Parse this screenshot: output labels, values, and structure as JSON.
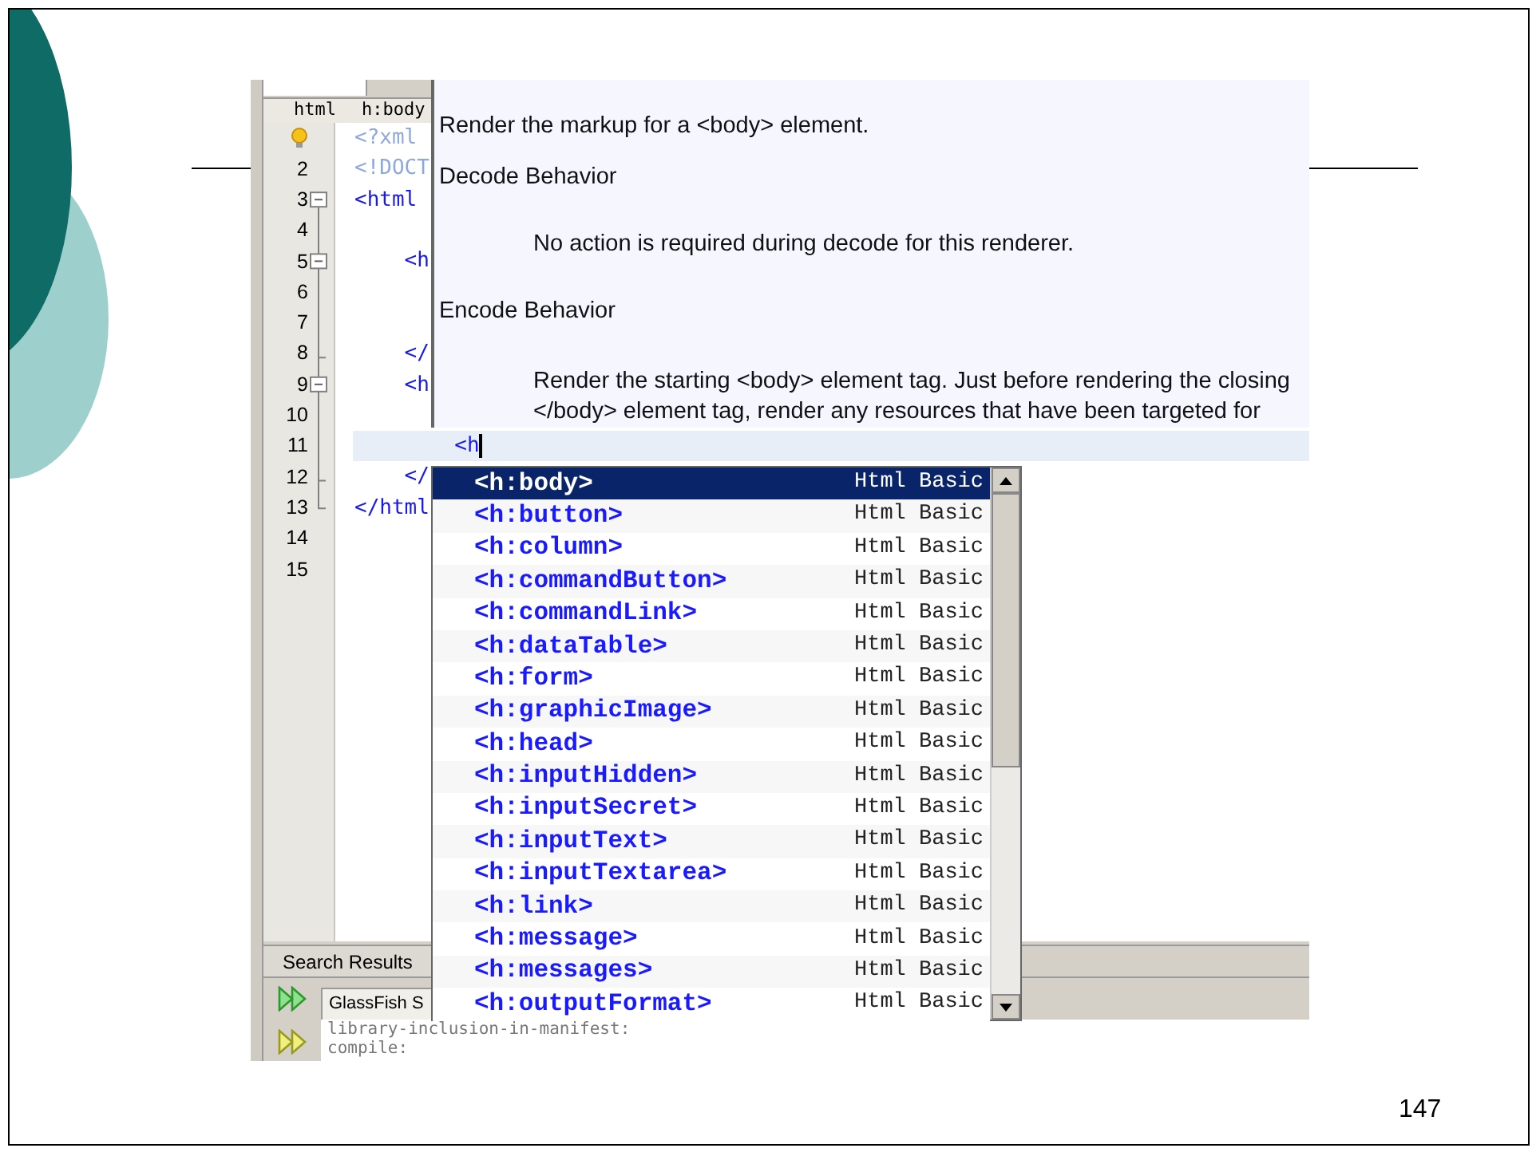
{
  "slide": {
    "page_number": "147"
  },
  "editor": {
    "breadcrumbs": [
      {
        "label": "html"
      },
      {
        "label": "h:body"
      }
    ],
    "lines": [
      {
        "kind": "hint",
        "text": "<?xml",
        "declaration": true,
        "collapsible": false,
        "current": false
      },
      {
        "kind": "number",
        "number": "2",
        "text": "<!DOCT",
        "declaration": true,
        "collapsible": false,
        "current": false
      },
      {
        "kind": "number",
        "number": "3",
        "text": "<html",
        "declaration": false,
        "collapsible": true,
        "current": false
      },
      {
        "kind": "number",
        "number": "4",
        "collapsible": false,
        "current": false
      },
      {
        "kind": "number",
        "number": "5",
        "text": "    <h",
        "declaration": false,
        "collapsible": true,
        "current": false
      },
      {
        "kind": "number",
        "number": "6",
        "collapsible": false,
        "current": false
      },
      {
        "kind": "number",
        "number": "7",
        "collapsible": false,
        "current": false
      },
      {
        "kind": "number",
        "number": "8",
        "text": "    </",
        "declaration": false,
        "collapsible": false,
        "current": false
      },
      {
        "kind": "number",
        "number": "9",
        "text": "    <h",
        "declaration": false,
        "collapsible": true,
        "current": false
      },
      {
        "kind": "number",
        "number": "10",
        "collapsible": false,
        "current": false
      },
      {
        "kind": "number",
        "number": "11",
        "text": "        <h",
        "declaration": false,
        "collapsible": false,
        "current": true
      },
      {
        "kind": "number",
        "number": "12",
        "text": "    </",
        "declaration": false,
        "collapsible": false,
        "current": false
      },
      {
        "kind": "number",
        "number": "13",
        "text": "</html",
        "declaration": false,
        "collapsible": false,
        "current": false
      },
      {
        "kind": "number",
        "number": "14",
        "collapsible": false,
        "current": false
      },
      {
        "kind": "number",
        "number": "15",
        "collapsible": false,
        "current": false
      }
    ]
  },
  "documentation": {
    "paragraphs": [
      {
        "kind": "text",
        "text": "Render the markup for a <body> element."
      },
      {
        "kind": "heading",
        "text": "Decode Behavior"
      },
      {
        "kind": "indented",
        "text": "No action is required during decode for this renderer."
      },
      {
        "kind": "heading",
        "text": "Encode Behavior"
      },
      {
        "kind": "indented",
        "text": "Render the starting <body> element tag. Just before rendering the closing </body> element tag, render any resources that have been targeted for"
      }
    ]
  },
  "completion": {
    "items": [
      {
        "name": "<h:body>",
        "library": "Html Basic",
        "selected": true
      },
      {
        "name": "<h:button>",
        "library": "Html Basic",
        "selected": false
      },
      {
        "name": "<h:column>",
        "library": "Html Basic",
        "selected": false
      },
      {
        "name": "<h:commandButton>",
        "library": "Html Basic",
        "selected": false
      },
      {
        "name": "<h:commandLink>",
        "library": "Html Basic",
        "selected": false
      },
      {
        "name": "<h:dataTable>",
        "library": "Html Basic",
        "selected": false
      },
      {
        "name": "<h:form>",
        "library": "Html Basic",
        "selected": false
      },
      {
        "name": "<h:graphicImage>",
        "library": "Html Basic",
        "selected": false
      },
      {
        "name": "<h:head>",
        "library": "Html Basic",
        "selected": false
      },
      {
        "name": "<h:inputHidden>",
        "library": "Html Basic",
        "selected": false
      },
      {
        "name": "<h:inputSecret>",
        "library": "Html Basic",
        "selected": false
      },
      {
        "name": "<h:inputText>",
        "library": "Html Basic",
        "selected": false
      },
      {
        "name": "<h:inputTextarea>",
        "library": "Html Basic",
        "selected": false
      },
      {
        "name": "<h:link>",
        "library": "Html Basic",
        "selected": false
      },
      {
        "name": "<h:message>",
        "library": "Html Basic",
        "selected": false
      },
      {
        "name": "<h:messages>",
        "library": "Html Basic",
        "selected": false
      },
      {
        "name": "<h:outputFormat>",
        "library": "Html Basic",
        "selected": false
      }
    ]
  },
  "bottom_panel": {
    "tabs": [
      {
        "label": "Search Results"
      },
      {
        "label": "GlassFish S"
      }
    ],
    "output": [
      "library-inclusion-in-manifest:",
      "compile:"
    ]
  }
}
